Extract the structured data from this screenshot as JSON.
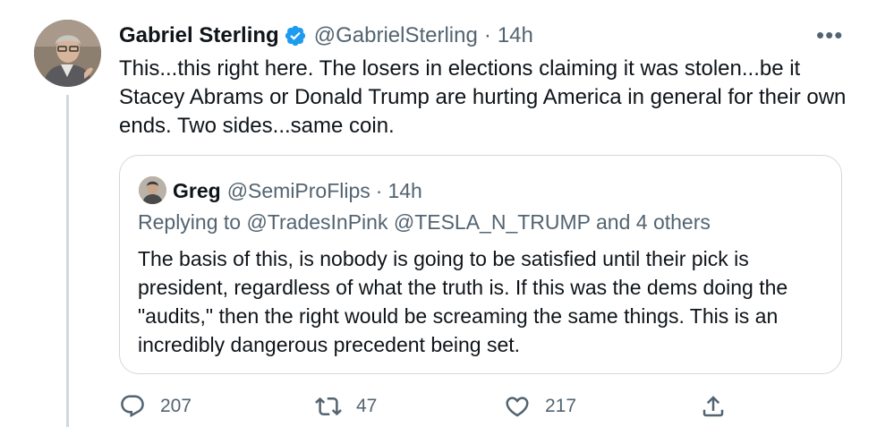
{
  "tweet": {
    "author_name": "Gabriel Sterling",
    "handle": "@GabrielSterling",
    "separator": "·",
    "time": "14h",
    "more": "•••",
    "text": "This...this right here. The losers in elections claiming it was stolen...be it Stacey Abrams or Donald Trump are hurting America in general for their own ends. Two sides...same coin."
  },
  "quoted": {
    "author_name": "Greg",
    "handle": "@SemiProFlips",
    "separator": "·",
    "time": "14h",
    "replying_to": "Replying to @TradesInPink @TESLA_N_TRUMP and 4 others",
    "text": "The basis of this, is nobody is going to be satisfied until their pick is president, regardless of what the truth is. If this was the dems doing the \"audits,\" then the right would be screaming the same things. This is an incredibly dangerous precedent being set."
  },
  "actions": {
    "reply_count": "207",
    "retweet_count": "47",
    "like_count": "217"
  },
  "icons": {
    "verified": "verified-badge-icon",
    "reply": "reply-icon",
    "retweet": "retweet-icon",
    "like": "heart-icon",
    "share": "share-icon",
    "more": "more-icon"
  },
  "colors": {
    "text": "#0f1419",
    "secondary": "#536471",
    "verified": "#1d9bf0",
    "border": "#cfd9de"
  }
}
